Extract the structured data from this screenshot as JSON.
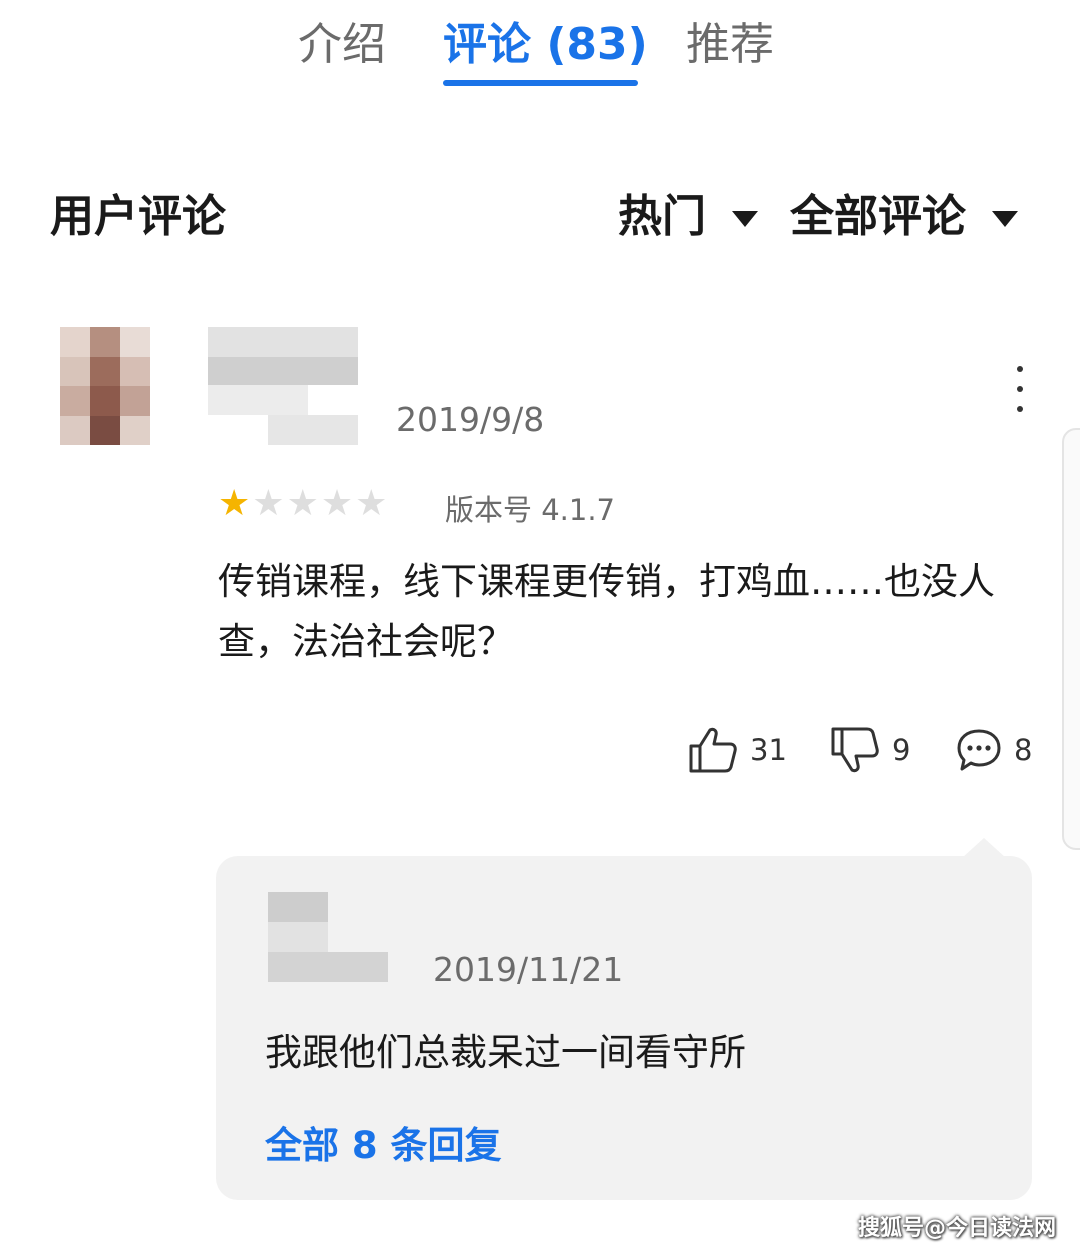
{
  "tabs": [
    {
      "label": "介绍",
      "active": false
    },
    {
      "label": "评论 (83)",
      "active": true
    },
    {
      "label": "推荐",
      "active": false
    }
  ],
  "colors": {
    "accent": "#1a73e8",
    "star": "#f5b400",
    "reply_bg": "#f2f2f2"
  },
  "section_title": "用户评论",
  "filters": {
    "sort": "热门",
    "scope": "全部评论"
  },
  "review": {
    "author_blurred": true,
    "date": "2019/9/8",
    "rating": 1,
    "rating_max": 5,
    "version": "版本号 4.1.7",
    "text": "传销课程，线下课程更传销，打鸡血……也没人查，法治社会呢？",
    "likes": "31",
    "dislikes": "9",
    "comments": "8",
    "icons": {
      "like": "thumbs-up-icon",
      "dislike": "thumbs-down-icon",
      "comment": "speech-bubble-icon",
      "more": "more-vertical-icon"
    }
  },
  "reply": {
    "author_blurred": true,
    "date": "2019/11/21",
    "text": "我跟他们总裁呆过一间看守所",
    "all_replies": "全部 8 条回复"
  },
  "watermark": "搜狐号@今日读法网"
}
